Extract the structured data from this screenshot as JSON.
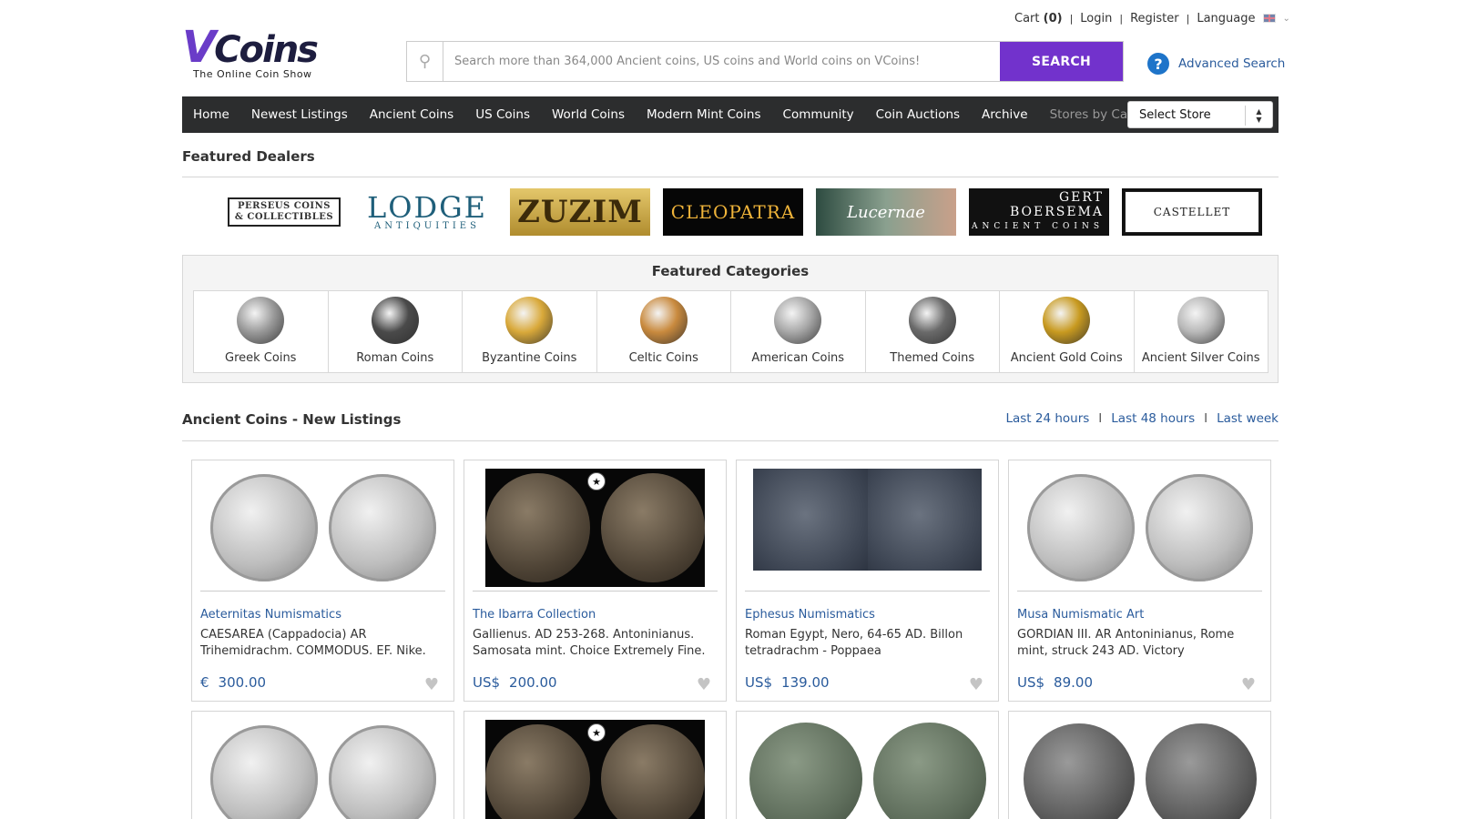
{
  "topbar": {
    "cart_label": "Cart",
    "cart_count": "(0)",
    "login": "Login",
    "register": "Register",
    "language": "Language"
  },
  "logo": {
    "brand": "VCoins",
    "tagline": "The Online Coin Show"
  },
  "search": {
    "placeholder": "Search more than 364,000 Ancient coins, US coins and World coins on VCoins!",
    "button": "SEARCH",
    "advanced": "Advanced Search"
  },
  "nav": {
    "items": [
      "Home",
      "Newest Listings",
      "Ancient Coins",
      "US Coins",
      "World Coins",
      "Modern Mint Coins",
      "Community",
      "Coin Auctions",
      "Archive"
    ],
    "stores_by_category": "Stores by Category",
    "select_store": "Select Store"
  },
  "featured_dealers": {
    "title": "Featured Dealers",
    "dealers": [
      {
        "line1": "PERSEUS COINS",
        "line2": "& COLLECTIBLES"
      },
      {
        "line1": "LODGE",
        "line2": "ANTIQUITIES"
      },
      {
        "line1": "ZUZIM"
      },
      {
        "line1": "CLEOPATRA"
      },
      {
        "line1": "Lucernae"
      },
      {
        "line1": "GERT",
        "line2": "BOERSEMA",
        "line3": "ANCIENT COINS"
      },
      {
        "line1": "CASTELLET"
      }
    ]
  },
  "featured_categories": {
    "title": "Featured Categories",
    "items": [
      "Greek Coins",
      "Roman Coins",
      "Byzantine Coins",
      "Celtic Coins",
      "American Coins",
      "Themed Coins",
      "Ancient Gold Coins",
      "Ancient Silver Coins"
    ],
    "coin_colors": [
      "#9a9a9a",
      "#4a4a4a",
      "#d9a93a",
      "#c98a3e",
      "#a8a8a8",
      "#6a6a6a",
      "#c89a20",
      "#b8b8b8"
    ]
  },
  "new_listings": {
    "title": "Ancient Coins - New Listings",
    "filters": [
      "Last 24 hours",
      "Last 48 hours",
      "Last week"
    ],
    "cards": [
      {
        "dealer": "Aeternitas Numismatics",
        "desc": "CAESAREA (Cappadocia) AR Trihemidrachm. COMMODUS. EF. Nike.",
        "currency": "€",
        "price": "300.00"
      },
      {
        "dealer": "The Ibarra Collection",
        "desc": "Gallienus. AD 253-268. Antoninianus. Samosata mint. Choice Extremely Fine.",
        "currency": "US$",
        "price": "200.00"
      },
      {
        "dealer": "Ephesus Numismatics",
        "desc": "Roman Egypt, Nero, 64-65 AD. Billon tetradrachm - Poppaea",
        "currency": "US$",
        "price": "139.00"
      },
      {
        "dealer": "Musa Numismatic Art",
        "desc": "GORDIAN III. AR Antoninianus, Rome mint, struck 243 AD. Victory",
        "currency": "US$",
        "price": "89.00"
      }
    ]
  },
  "colors": {
    "accent": "#7232cc",
    "link": "#2a5b9c",
    "nav_bg": "#2c2d2e"
  }
}
